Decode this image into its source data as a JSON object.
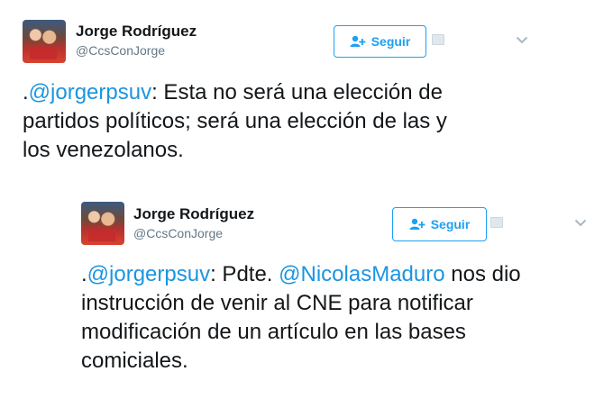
{
  "tweets": [
    {
      "author": {
        "name": "Jorge Rodríguez",
        "handle": "@CcsConJorge"
      },
      "follow_label": "Seguir",
      "text": {
        "prefix": ".",
        "mention": "@jorgerpsuv",
        "line1_rest": ": Esta no será una elección de",
        "line2": "partidos políticos; será una elección de las y",
        "line3": "los venezolanos."
      }
    },
    {
      "author": {
        "name": "Jorge Rodríguez",
        "handle": "@CcsConJorge"
      },
      "follow_label": "Seguir",
      "text": {
        "prefix": ".",
        "mention1": "@jorgerpsuv",
        "mid": ": Pdte. ",
        "mention2": "@NicolasMaduro",
        "line1_rest": " nos dio",
        "line2": "instrucción de venir al CNE para notificar",
        "line3": "modificación de un artículo en las bases",
        "line4": "comiciales."
      }
    }
  ],
  "icons": {
    "follow": "add-user-icon",
    "menu": "chevron-down-icon",
    "placeholder": "broken-image-icon"
  },
  "colors": {
    "accent": "#1da1f2",
    "mention": "#1b95e0",
    "handle": "#657786",
    "text": "#14171a"
  }
}
